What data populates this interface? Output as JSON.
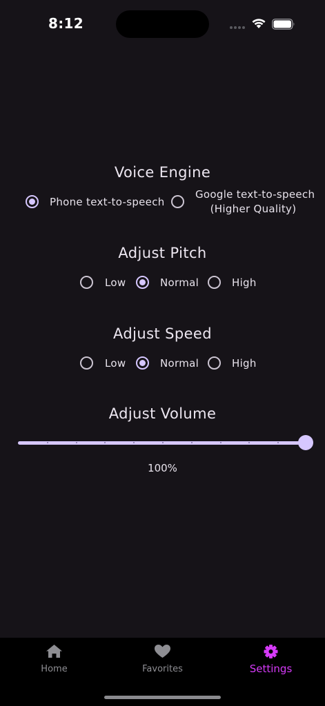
{
  "status_bar": {
    "time": "8:12"
  },
  "voice_engine": {
    "title": "Voice Engine",
    "options": [
      {
        "label": "Phone text-to-speech",
        "selected": true
      },
      {
        "label_line1": "Google text-to-speech",
        "label_line2": "(Higher Quality)",
        "selected": false
      }
    ]
  },
  "pitch": {
    "title": "Adjust Pitch",
    "options": [
      {
        "label": "Low",
        "selected": false
      },
      {
        "label": "Normal",
        "selected": true
      },
      {
        "label": "High",
        "selected": false
      }
    ]
  },
  "speed": {
    "title": "Adjust Speed",
    "options": [
      {
        "label": "Low",
        "selected": false
      },
      {
        "label": "Normal",
        "selected": true
      },
      {
        "label": "High",
        "selected": false
      }
    ]
  },
  "volume": {
    "title": "Adjust Volume",
    "value_percent": 100,
    "value_label": "100%"
  },
  "bottom_nav": {
    "items": [
      {
        "label": "Home",
        "icon": "home-icon",
        "active": false
      },
      {
        "label": "Favorites",
        "icon": "heart-icon",
        "active": false
      },
      {
        "label": "Settings",
        "icon": "gear-icon",
        "active": true
      }
    ]
  },
  "colors": {
    "background": "#161318",
    "accent": "#D6C7FF",
    "active_tab": "#D63AF9",
    "inactive_tab": "#8E8E93"
  }
}
